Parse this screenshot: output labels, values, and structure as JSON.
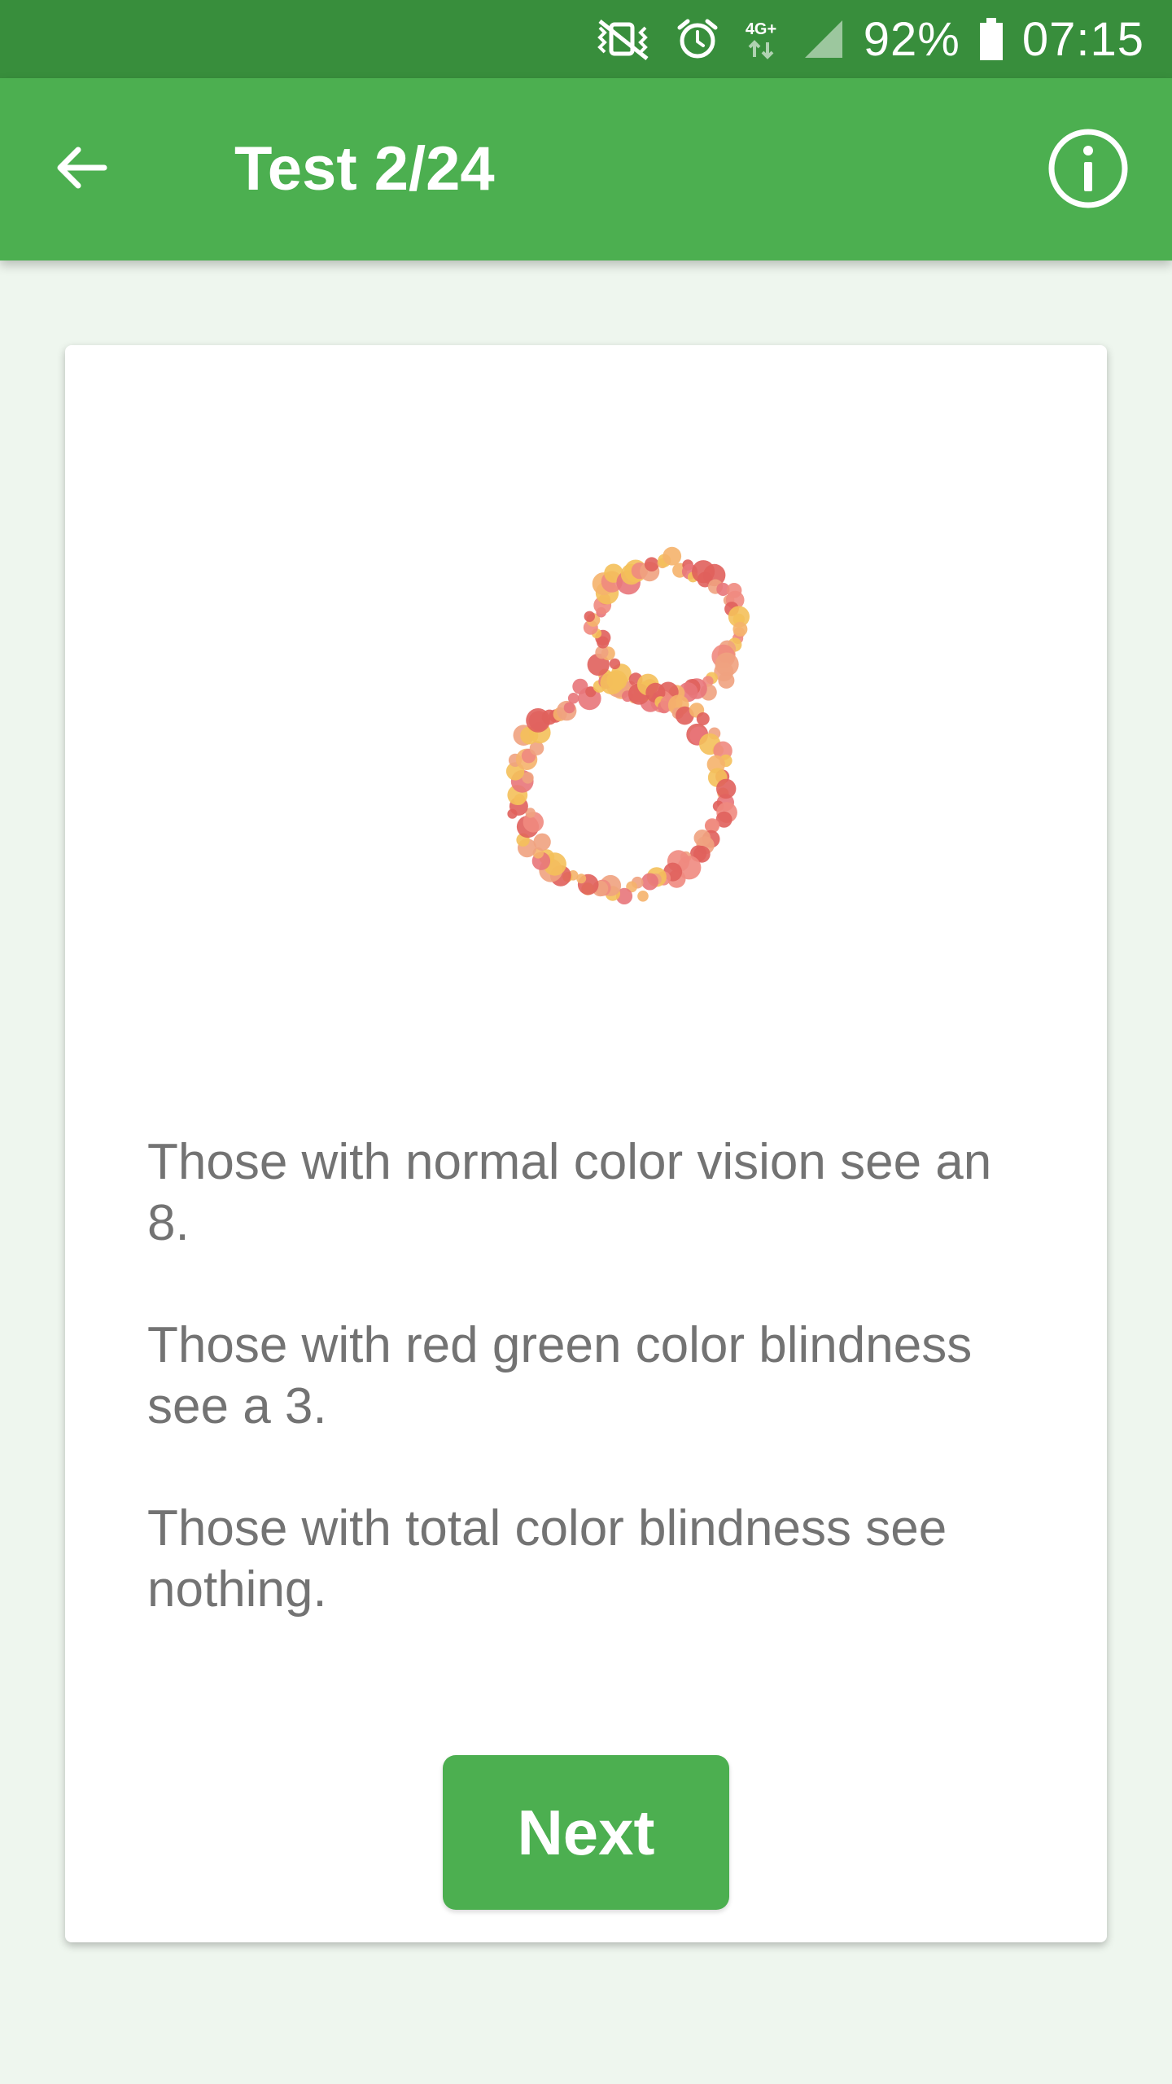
{
  "status_bar": {
    "battery_percent": "92%",
    "time": "07:15",
    "network_label": "4G+",
    "icons": [
      "vibrate-icon",
      "alarm-icon",
      "network-4g-icon",
      "signal-icon",
      "battery-icon"
    ]
  },
  "app_bar": {
    "title": "Test 2/24",
    "back_icon": "arrow-left-icon",
    "info_icon": "info-icon"
  },
  "test": {
    "plate_figure": "8",
    "lines": [
      "Those with normal color vision see an 8.",
      "Those with red green color blindness see a 3.",
      "Those with total color blindness see nothing."
    ]
  },
  "actions": {
    "next_label": "Next"
  },
  "colors": {
    "status_bar": "#388e3c",
    "app_bar": "#4caf50",
    "background": "#eef6ee",
    "card": "#ffffff",
    "text": "#737373",
    "button": "#4caf50",
    "dots": [
      "#e0605c",
      "#f0a27f",
      "#f5b26b",
      "#e8757a",
      "#f4c05a",
      "#f08a80"
    ]
  }
}
